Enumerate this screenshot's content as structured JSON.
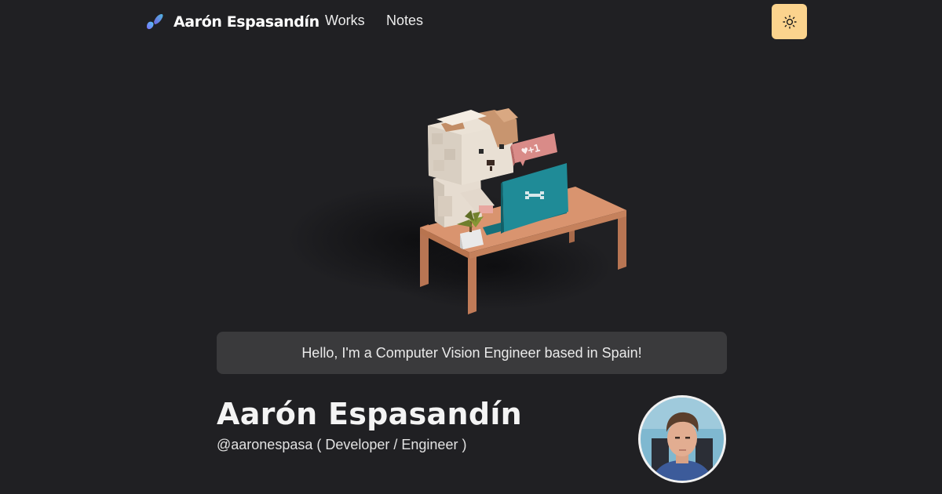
{
  "nav": {
    "brand_name": "Aarón Espasandín",
    "links": [
      {
        "label": "Works"
      },
      {
        "label": "Notes"
      }
    ],
    "theme_toggle_icon": "sun-icon"
  },
  "hero": {
    "illustration": "voxel-dog-at-desk",
    "badge_text": "♥+1"
  },
  "greeting": {
    "text": "Hello, I'm a Computer Vision Engineer based in Spain!"
  },
  "profile": {
    "name": "Aarón Espasandín",
    "handle": "@aaronespasa ( Developer / Engineer )",
    "avatar_icon": "profile-photo"
  },
  "colors": {
    "background": "#202023",
    "accent": "#fbd38d",
    "greeting_bg": "#3a3a3c",
    "laptop": "#1f8b97",
    "desk": "#d4906b"
  }
}
